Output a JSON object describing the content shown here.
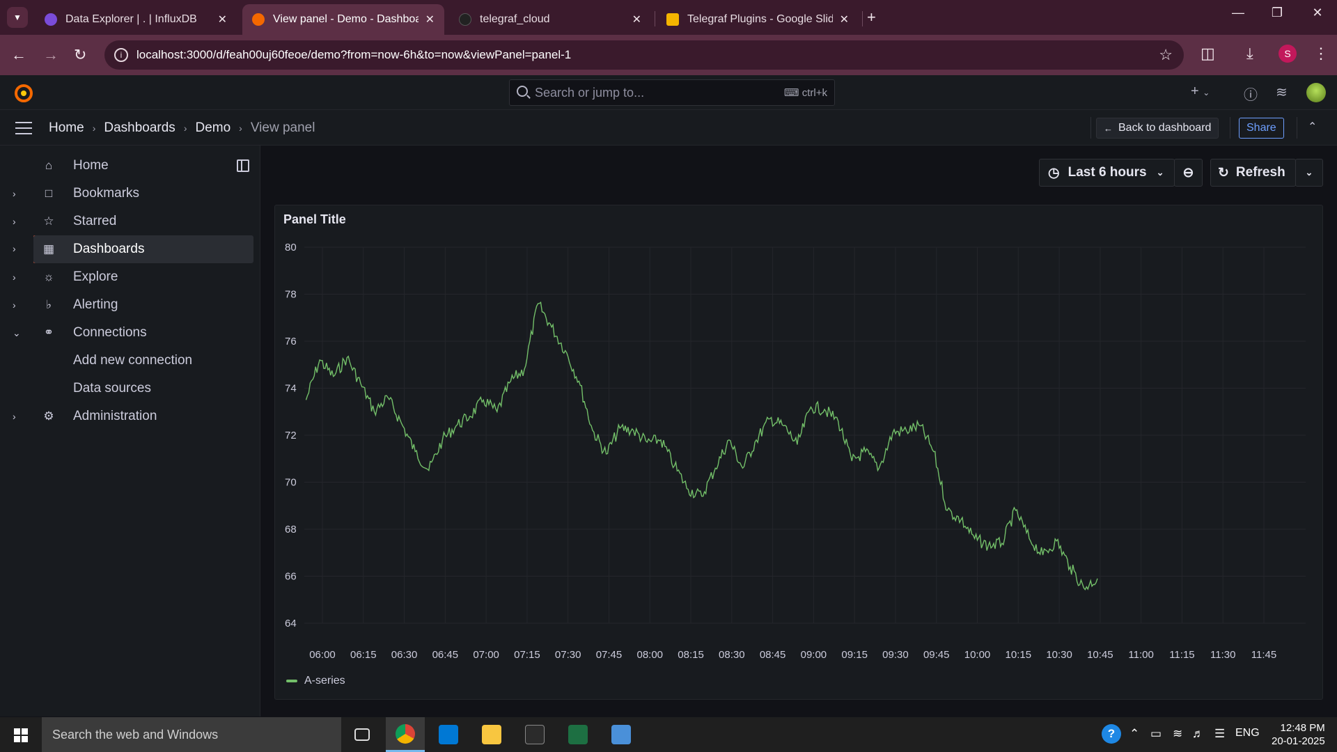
{
  "browser": {
    "tabs": [
      {
        "label": "Data Explorer | . | InfluxDB",
        "favicon_color": "#7a4cd9"
      },
      {
        "label": "View panel - Demo - Dashboards",
        "favicon_color": "#f46800"
      },
      {
        "label": "telegraf_cloud",
        "favicon_color": "#222222"
      },
      {
        "label": "Telegraf Plugins - Google Slides",
        "favicon_color": "#f4b400"
      }
    ],
    "url": "localhost:3000/d/feah00uj60feoe/demo?from=now-6h&to=now&viewPanel=panel-1",
    "profile_initial": "S"
  },
  "grafana": {
    "search_placeholder": "Search or jump to...",
    "search_shortcut": "ctrl+k",
    "breadcrumb": [
      "Home",
      "Dashboards",
      "Demo",
      "View panel"
    ],
    "back_label": "Back to dashboard",
    "share_label": "Share",
    "sidebar": [
      {
        "label": "Home",
        "icon": "home-icon"
      },
      {
        "label": "Bookmarks",
        "icon": "bookmark-icon"
      },
      {
        "label": "Starred",
        "icon": "star-icon"
      },
      {
        "label": "Dashboards",
        "icon": "dashboards-icon",
        "active": true
      },
      {
        "label": "Explore",
        "icon": "compass-icon"
      },
      {
        "label": "Alerting",
        "icon": "bell-icon"
      },
      {
        "label": "Connections",
        "icon": "connections-icon",
        "expanded": true
      },
      {
        "label": "Add new connection",
        "sub": true
      },
      {
        "label": "Data sources",
        "sub": true
      },
      {
        "label": "Administration",
        "icon": "gear-icon"
      }
    ],
    "time_range": "Last 6 hours",
    "refresh_label": "Refresh"
  },
  "panel": {
    "title": "Panel Title"
  },
  "chart_data": {
    "type": "line",
    "title": "Panel Title",
    "ylim": [
      64,
      80
    ],
    "yticks": [
      80,
      78,
      76,
      74,
      72,
      70,
      68,
      66,
      64
    ],
    "xticks": [
      "06:00",
      "06:15",
      "06:30",
      "06:45",
      "07:00",
      "07:15",
      "07:30",
      "07:45",
      "08:00",
      "08:15",
      "08:30",
      "08:45",
      "09:00",
      "09:15",
      "09:30",
      "09:45",
      "10:00",
      "10:15",
      "10:30",
      "10:45",
      "11:00",
      "11:15",
      "11:30",
      "11:45"
    ],
    "grid": true,
    "legend": "bottom-left",
    "series": [
      {
        "name": "A-series",
        "color": "#73bf69",
        "x_start": "05:54",
        "x_step_minutes": 5,
        "values": [
          73.5,
          75.2,
          74.5,
          75.3,
          74.2,
          73.0,
          73.6,
          72.5,
          71.3,
          70.5,
          71.8,
          72.4,
          72.8,
          73.5,
          73.0,
          74.3,
          74.8,
          77.6,
          76.6,
          75.6,
          74.3,
          72.2,
          71.2,
          72.3,
          72.2,
          71.7,
          71.8,
          70.7,
          69.7,
          69.4,
          70.6,
          71.8,
          70.6,
          71.8,
          72.7,
          72.4,
          71.6,
          73.2,
          73.1,
          72.6,
          70.9,
          71.3,
          70.6,
          72.1,
          72.2,
          72.4,
          71.3,
          68.8,
          68.4,
          67.6,
          67.3,
          67.4,
          68.8,
          67.6,
          66.9,
          67.5,
          66.4,
          65.5,
          65.9
        ]
      }
    ]
  },
  "taskbar": {
    "search_placeholder": "Search the web and Windows",
    "lang": "ENG",
    "time": "12:48 PM",
    "date": "20-01-2025"
  }
}
